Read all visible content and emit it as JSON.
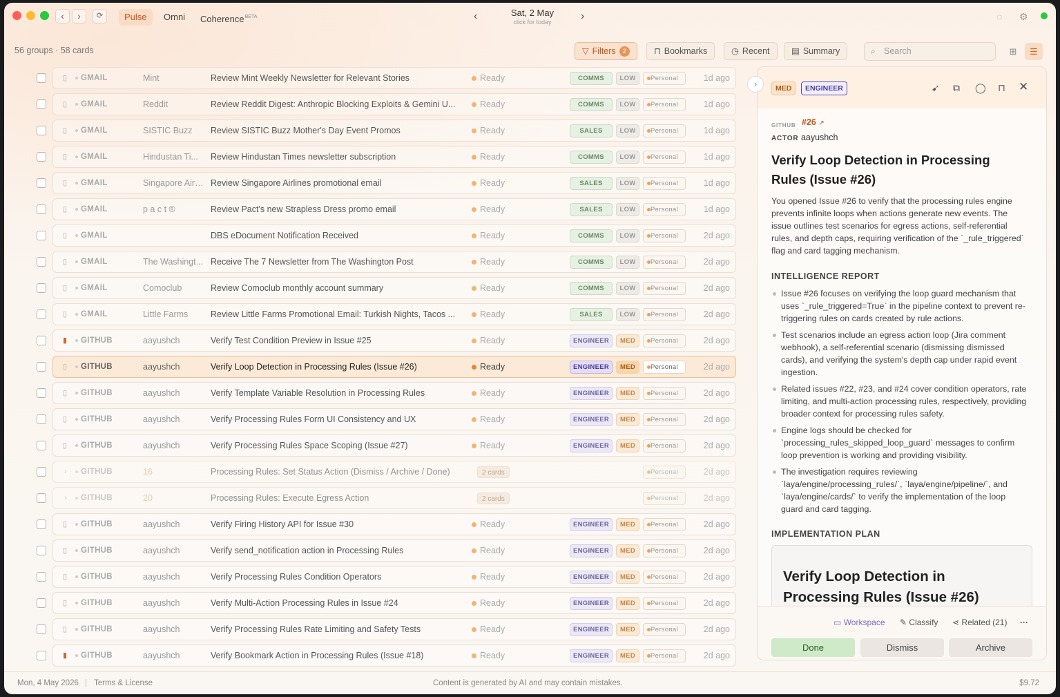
{
  "app": {
    "tabs": [
      {
        "label": "Pulse"
      },
      {
        "label": "Omni"
      },
      {
        "label": "Coherence",
        "sup": "BETA"
      }
    ],
    "date": "Sat, 2 May",
    "date_sub": "click for today"
  },
  "toolbar": {
    "counts": "56 groups · 58 cards",
    "filters": "Filters",
    "filters_count": "2",
    "bookmarks": "Bookmarks",
    "recent": "Recent",
    "summary": "Summary",
    "search_placeholder": "Search"
  },
  "rows": [
    {
      "src": "GMAIL",
      "sender": "Mint",
      "title": "Review Mint Weekly Newsletter for Relevant Stories",
      "status": "Ready",
      "cat": "COMMS",
      "pri": "LOW",
      "per": "Personal",
      "ago": "1d ago"
    },
    {
      "src": "GMAIL",
      "sender": "Reddit",
      "title": "Review Reddit Digest: Anthropic Blocking Exploits & Gemini U...",
      "status": "Ready",
      "cat": "COMMS",
      "pri": "LOW",
      "per": "Personal",
      "ago": "1d ago"
    },
    {
      "src": "GMAIL",
      "sender": "SISTIC Buzz",
      "title": "Review SISTIC Buzz Mother's Day Event Promos",
      "status": "Ready",
      "cat": "SALES",
      "pri": "LOW",
      "per": "Personal",
      "ago": "1d ago"
    },
    {
      "src": "GMAIL",
      "sender": "Hindustan Ti...",
      "title": "Review Hindustan Times newsletter subscription",
      "status": "Ready",
      "cat": "COMMS",
      "pri": "LOW",
      "per": "Personal",
      "ago": "1d ago"
    },
    {
      "src": "GMAIL",
      "sender": "Singapore Airl...",
      "title": "Review Singapore Airlines promotional email",
      "status": "Ready",
      "cat": "SALES",
      "pri": "LOW",
      "per": "Personal",
      "ago": "1d ago"
    },
    {
      "src": "GMAIL",
      "sender": "p a c t ®",
      "title": "Review Pact's new Strapless Dress promo email",
      "status": "Ready",
      "cat": "SALES",
      "pri": "LOW",
      "per": "Personal",
      "ago": "1d ago"
    },
    {
      "src": "GMAIL",
      "sender": "",
      "title": "DBS eDocument Notification Received",
      "status": "Ready",
      "cat": "COMMS",
      "pri": "LOW",
      "per": "Personal",
      "ago": "2d ago"
    },
    {
      "src": "GMAIL",
      "sender": "The Washingt...",
      "title": "Receive The 7 Newsletter from The Washington Post",
      "status": "Ready",
      "cat": "COMMS",
      "pri": "LOW",
      "per": "Personal",
      "ago": "2d ago"
    },
    {
      "src": "GMAIL",
      "sender": "Comoclub",
      "title": "Review Comoclub monthly account summary",
      "status": "Ready",
      "cat": "COMMS",
      "pri": "LOW",
      "per": "Personal",
      "ago": "2d ago"
    },
    {
      "src": "GMAIL",
      "sender": "Little Farms",
      "title": "Review Little Farms Promotional Email: Turkish Nights, Tacos ...",
      "status": "Ready",
      "cat": "SALES",
      "pri": "LOW",
      "per": "Personal",
      "ago": "2d ago"
    },
    {
      "src": "GITHUB",
      "sender": "aayushch",
      "title": "Verify Test Condition Preview in Issue #25",
      "status": "Ready",
      "cat": "ENGINEER",
      "pri": "MED",
      "per": "Personal",
      "ago": "2d ago",
      "bm": true
    },
    {
      "src": "GITHUB",
      "sender": "aayushch",
      "title": "Verify Loop Detection in Processing Rules (Issue #26)",
      "status": "Ready",
      "cat": "ENGINEER",
      "pri": "MED",
      "per": "Personal",
      "ago": "2d ago",
      "sel": true
    },
    {
      "src": "GITHUB",
      "sender": "aayushch",
      "title": "Verify Template Variable Resolution in Processing Rules",
      "status": "Ready",
      "cat": "ENGINEER",
      "pri": "MED",
      "per": "Personal",
      "ago": "2d ago"
    },
    {
      "src": "GITHUB",
      "sender": "aayushch",
      "title": "Verify Processing Rules Form UI Consistency and UX",
      "status": "Ready",
      "cat": "ENGINEER",
      "pri": "MED",
      "per": "Personal",
      "ago": "2d ago"
    },
    {
      "src": "GITHUB",
      "sender": "aayushch",
      "title": "Verify Processing Rules Space Scoping (Issue #27)",
      "status": "Ready",
      "cat": "ENGINEER",
      "pri": "MED",
      "per": "Personal",
      "ago": "2d ago"
    },
    {
      "src": "GITHUB",
      "group": "16",
      "title": "Processing Rules: Set Status Action (Dismiss / Archive / Done)",
      "cards": "2 cards",
      "per": "Personal",
      "ago": "2d ago"
    },
    {
      "src": "GITHUB",
      "group": "20",
      "title": "Processing Rules: Execute Egress Action",
      "cards": "2 cards",
      "per": "Personal",
      "ago": "2d ago"
    },
    {
      "src": "GITHUB",
      "sender": "aayushch",
      "title": "Verify Firing History API for Issue #30",
      "status": "Ready",
      "cat": "ENGINEER",
      "pri": "MED",
      "per": "Personal",
      "ago": "2d ago"
    },
    {
      "src": "GITHUB",
      "sender": "aayushch",
      "title": "Verify send_notification action in Processing Rules",
      "status": "Ready",
      "cat": "ENGINEER",
      "pri": "MED",
      "per": "Personal",
      "ago": "2d ago"
    },
    {
      "src": "GITHUB",
      "sender": "aayushch",
      "title": "Verify Processing Rules Condition Operators",
      "status": "Ready",
      "cat": "ENGINEER",
      "pri": "MED",
      "per": "Personal",
      "ago": "2d ago"
    },
    {
      "src": "GITHUB",
      "sender": "aayushch",
      "title": "Verify Multi-Action Processing Rules in Issue #24",
      "status": "Ready",
      "cat": "ENGINEER",
      "pri": "MED",
      "per": "Personal",
      "ago": "2d ago"
    },
    {
      "src": "GITHUB",
      "sender": "aayushch",
      "title": "Verify Processing Rules Rate Limiting and Safety Tests",
      "status": "Ready",
      "cat": "ENGINEER",
      "pri": "MED",
      "per": "Personal",
      "ago": "2d ago"
    },
    {
      "src": "GITHUB",
      "sender": "aayushch",
      "title": "Verify Bookmark Action in Processing Rules (Issue #18)",
      "status": "Ready",
      "cat": "ENGINEER",
      "pri": "MED",
      "per": "Personal",
      "ago": "2d ago",
      "bm": true
    }
  ],
  "detail": {
    "priority": "MED",
    "category": "ENGINEER",
    "source_label": "GITHUB",
    "issue": "#26",
    "actor_label": "ACTOR",
    "actor": "aayushch",
    "title": "Verify Loop Detection in Processing Rules (Issue #26)",
    "summary": "You opened Issue #26 to verify that the processing rules engine prevents infinite loops when actions generate new events. The issue outlines test scenarios for egress actions, self-referential rules, and depth caps, requiring verification of the `_rule_triggered` flag and card tagging mechanism.",
    "report_heading": "INTELLIGENCE REPORT",
    "report": [
      "Issue #26 focuses on verifying the loop guard mechanism that uses `_rule_triggered=True` in the pipeline context to prevent re-triggering rules on cards created by rule actions.",
      "Test scenarios include an egress action loop (Jira comment webhook), a self-referential scenario (dismissing dismissed cards), and verifying the system's depth cap under rapid event ingestion.",
      "Related issues #22, #23, and #24 cover condition operators, rate limiting, and multi-action processing rules, respectively, providing broader context for processing rules safety.",
      "Engine logs should be checked for `processing_rules_skipped_loop_guard` messages to confirm loop prevention is working and providing visibility.",
      "The investigation requires reviewing `laya/engine/processing_rules/`, `laya/engine/pipeline/`, and `laya/engine/cards/` to verify the implementation of the loop guard and card tagging."
    ],
    "plan_heading": "IMPLEMENTATION PLAN",
    "plan_title": "Verify Loop Detection in Processing Rules (Issue #26)",
    "links": {
      "workspace": "Workspace",
      "classify": "Classify",
      "related": "Related (21)"
    },
    "actions": {
      "done": "Done",
      "dismiss": "Dismiss",
      "archive": "Archive"
    }
  },
  "status": {
    "date": "Mon, 4 May 2026",
    "terms": "Terms & License",
    "disclaimer": "Content is generated by AI and may contain mistakes.",
    "cost": "$9.72"
  },
  "colors": {
    "accent": "#c0581e",
    "done": "#cfeac8",
    "engineer": "#4d3c99",
    "med": "#c3864a"
  }
}
